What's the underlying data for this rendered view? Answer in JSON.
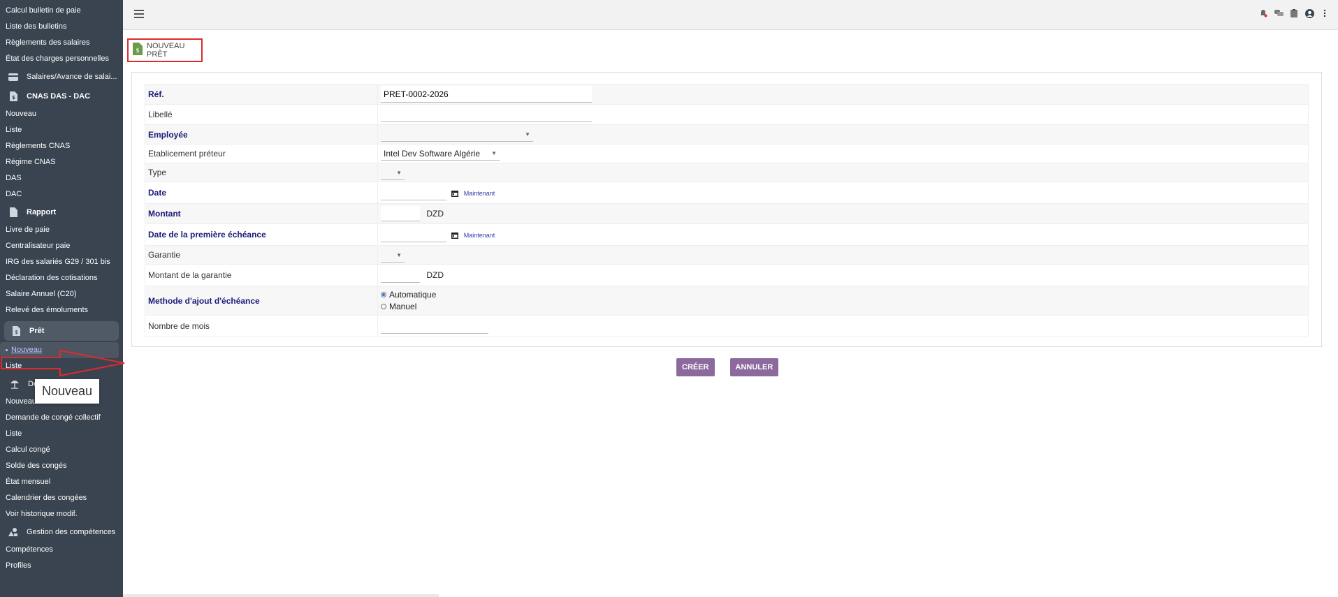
{
  "sidebar": {
    "group1": [
      "Calcul bulletin de paie",
      "Liste des bulletins",
      "Règlements des salaires",
      "État des charges personnelles"
    ],
    "salaires_section": "Salaires/Avance de salai...",
    "cnas_section": "CNAS DAS - DAC",
    "cnas_items": [
      "Nouveau",
      "Liste",
      "Règlements CNAS",
      "Régime CNAS",
      "DAS",
      "DAC"
    ],
    "rapport_section": "Rapport",
    "rapport_items": [
      "Livre de paie",
      "Centralisateur paie",
      "IRG des salariés G29 / 301 bis",
      "Déclaration des cotisations",
      "Salaire Annuel (C20)",
      "Relevé des émoluments"
    ],
    "pret_section": "Prêt",
    "pret_items": [
      "Nouveau",
      "Liste"
    ],
    "conge_section": "De",
    "conge_items": [
      "Nouveau",
      "Demande de congé collectif",
      "Liste",
      "Calcul congé",
      "Solde des congés",
      "État mensuel",
      "Calendrier des congées",
      "Voir historique modif."
    ],
    "competences_section": "Gestion des compétences",
    "competences_items": [
      "Compétences",
      "Profiles"
    ],
    "tooltip": "Nouveau"
  },
  "page": {
    "title": "NOUVEAU PRÊT"
  },
  "form": {
    "ref_label": "Réf.",
    "ref_value": "PRET-0002-2026",
    "libelle_label": "Libellé",
    "libelle_value": "",
    "employee_label": "Employée",
    "employee_value": "",
    "etab_label": "Etablicement préteur",
    "etab_value": "Intel Dev Software Algérie",
    "type_label": "Type",
    "type_value": "",
    "date_label": "Date",
    "date_value": "",
    "now_link": "Maintenant",
    "montant_label": "Montant",
    "montant_value": "",
    "currency": "DZD",
    "first_due_label": "Date de la première échéance",
    "first_due_value": "",
    "garantie_label": "Garantie",
    "garantie_value": "",
    "montant_garantie_label": "Montant de la garantie",
    "montant_garantie_value": "",
    "methode_label": "Methode d'ajout d'échéance",
    "methode_options": [
      "Automatique",
      "Manuel"
    ],
    "methode_selected": "Automatique",
    "mois_label": "Nombre de mois",
    "mois_value": ""
  },
  "buttons": {
    "create": "CRÉER",
    "cancel": "ANNULER"
  },
  "colors": {
    "sidebar": "#3a4350",
    "button": "#8c6a9e",
    "highlight": "#e02a2a",
    "required_label": "#1a1a7a"
  }
}
